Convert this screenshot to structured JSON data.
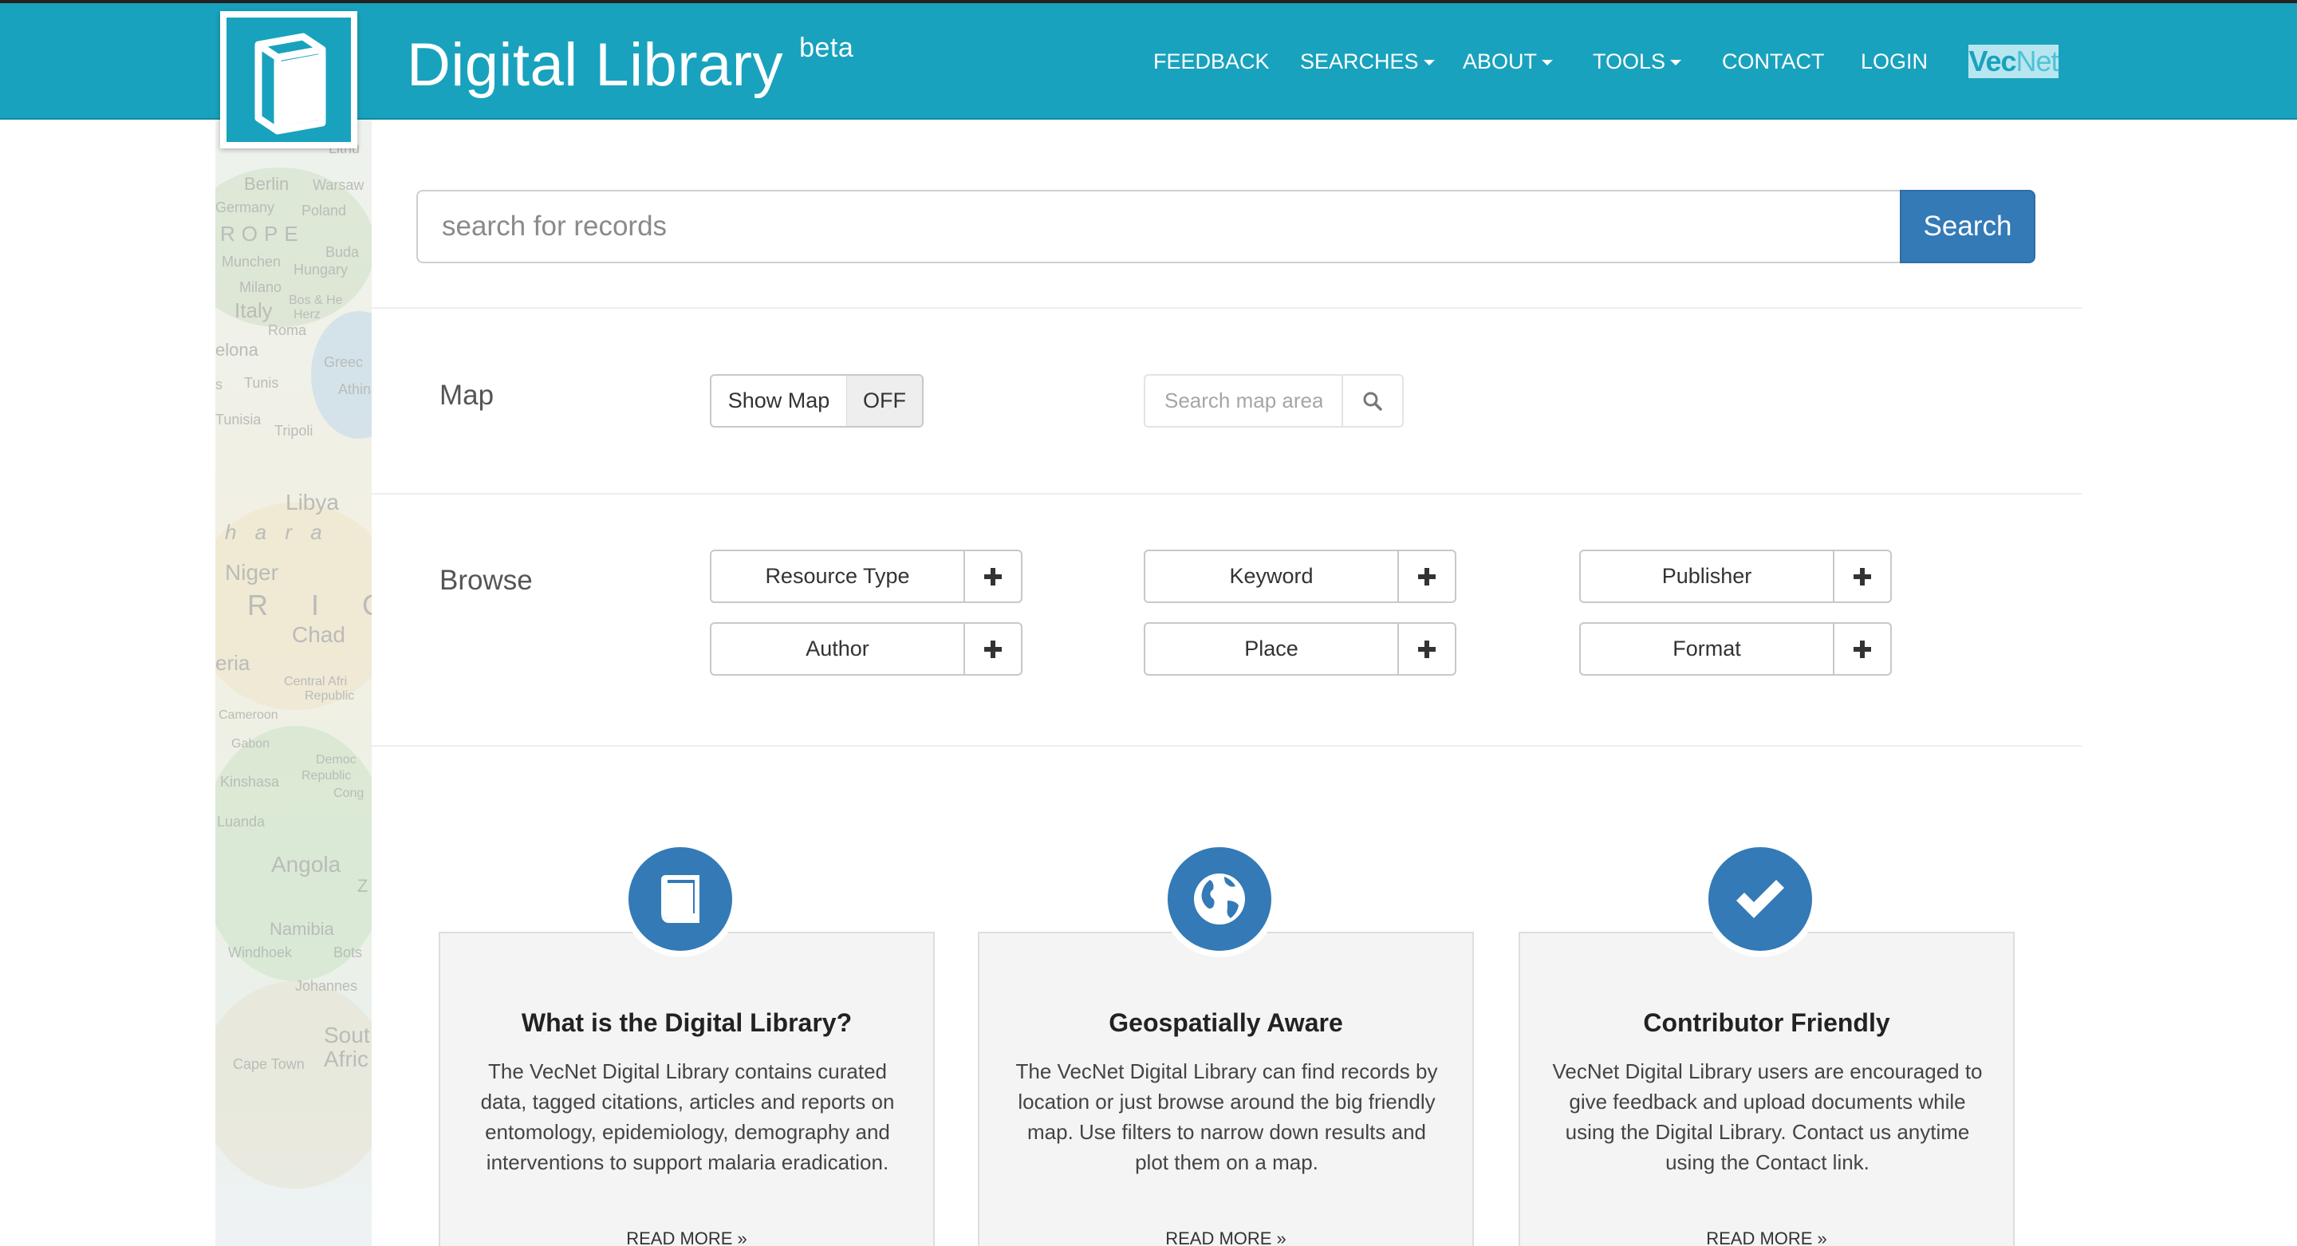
{
  "header": {
    "title": "Digital Library",
    "badge": "beta",
    "nav": {
      "feedback": "FEEDBACK",
      "searches": "SEARCHES",
      "about": "ABOUT",
      "tools": "TOOLS",
      "contact": "CONTACT",
      "login": "LOGIN"
    },
    "partner_logo": {
      "part1": "Vec",
      "part2": "Net"
    },
    "colors": {
      "bar": "#19a2bd",
      "accent": "#337ab7"
    }
  },
  "map_strip": {
    "labels": [
      "Lithu",
      "Berlin",
      "Warsaw",
      "Germany",
      "Poland",
      "ROPE",
      "Munchen",
      "Buda",
      "Hungary",
      "Milano",
      "Bos & He",
      "Italy",
      "Herz",
      "Roma",
      "elona",
      "Greec",
      "s",
      "Tunis",
      "Athinai",
      "Tunisia",
      "Tripoli",
      "Libya",
      "h a r a",
      "Niger",
      "R I C",
      "Chad",
      "eria",
      "Central Afri",
      "Republic",
      "Cameroon",
      "Gabon",
      "Democ",
      "Kinshasa",
      "Republic",
      "Cong",
      "Luanda",
      "Angola",
      "Z",
      "Namibia",
      "Windhoek",
      "Bots",
      "Johannes",
      "Sout",
      "Cape Town",
      "Afric"
    ]
  },
  "search": {
    "placeholder": "search for records",
    "button": "Search"
  },
  "map_section": {
    "label": "Map",
    "toggle_label": "Show Map",
    "toggle_state": "OFF",
    "area_placeholder": "Search map area",
    "icon": "search-icon"
  },
  "browse": {
    "label": "Browse",
    "facets": [
      "Resource Type",
      "Keyword",
      "Publisher",
      "Author",
      "Place",
      "Format"
    ],
    "add_icon": "plus-icon"
  },
  "features": [
    {
      "icon": "book-icon",
      "title": "What is the Digital Library?",
      "text": "The VecNet Digital Library contains curated data, tagged citations, articles and reports on entomology, epidemiology, demography and interventions to support malaria eradication.",
      "link": "READ MORE »"
    },
    {
      "icon": "globe-icon",
      "title": "Geospatially Aware",
      "text": "The VecNet Digital Library can find records by location or just browse around the big friendly map. Use filters to narrow down results and plot them on a map.",
      "link": "READ MORE »"
    },
    {
      "icon": "checkmark-icon",
      "title": "Contributor Friendly",
      "text": "VecNet Digital Library users are encouraged to give feedback and upload documents while using the Digital Library. Contact us anytime using the Contact link.",
      "link": "READ MORE »"
    }
  ]
}
